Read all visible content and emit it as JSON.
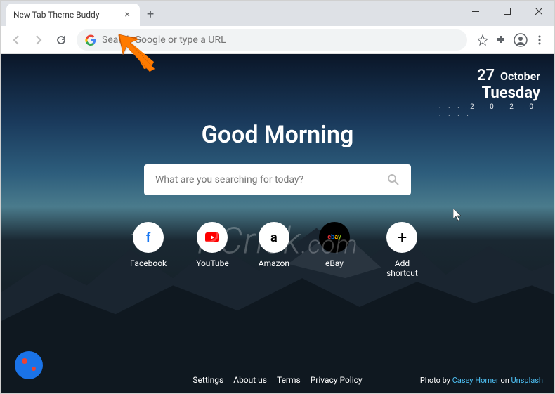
{
  "window": {
    "tab_title": "New Tab Theme Buddy"
  },
  "toolbar": {
    "omnibox_placeholder": "Search Google or type a URL"
  },
  "date": {
    "day": "27",
    "month": "October",
    "weekday": "Tuesday",
    "year": "2 0 2 0"
  },
  "page": {
    "greeting": "Good Morning",
    "search_placeholder": "What are you searching for today?"
  },
  "shortcuts": [
    {
      "label": "Facebook",
      "icon": "facebook"
    },
    {
      "label": "YouTube",
      "icon": "youtube"
    },
    {
      "label": "Amazon",
      "icon": "amazon"
    },
    {
      "label": "eBay",
      "icon": "ebay"
    },
    {
      "label": "Add shortcut",
      "icon": "add"
    }
  ],
  "footer": {
    "links": [
      "Settings",
      "About us",
      "Terms",
      "Privacy Policy"
    ],
    "credit_prefix": "Photo by ",
    "credit_author": "Casey Horner",
    "credit_middle": " on ",
    "credit_source": "Unsplash"
  },
  "watermark": {
    "brand": "PCrisk",
    "tld": ".com"
  }
}
